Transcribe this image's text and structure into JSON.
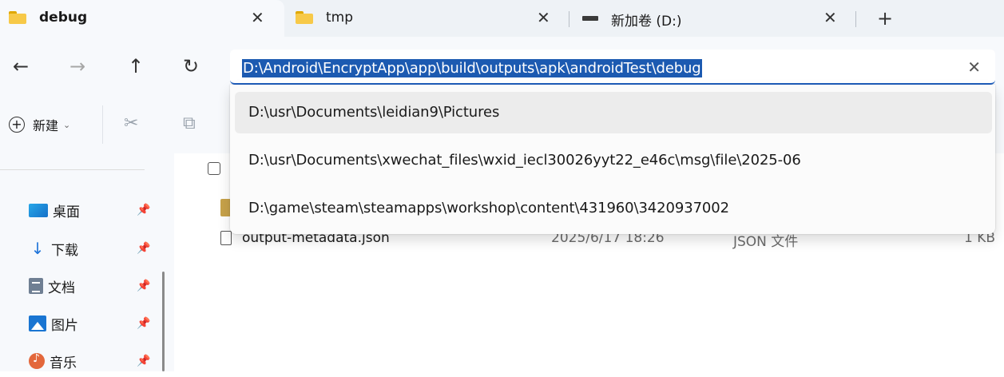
{
  "tabs": [
    {
      "title": "debug",
      "icon": "folder-icon",
      "active": true
    },
    {
      "title": "tmp",
      "icon": "folder-icon",
      "active": false
    },
    {
      "title": "新加卷 (D:)",
      "icon": "drive-icon",
      "active": false
    }
  ],
  "tab_close_glyph": "✕",
  "new_tab_glyph": "+",
  "nav": {
    "back": "←",
    "forward": "→",
    "up": "↑",
    "refresh": "↻"
  },
  "address": {
    "value": "D:\\Android\\EncryptApp\\app\\build\\outputs\\apk\\androidTest\\debug",
    "clear_glyph": "✕"
  },
  "suggestions": [
    "D:\\usr\\Documents\\leidian9\\Pictures",
    "D:\\usr\\Documents\\xwechat_files\\wxid_iecl30026yyt22_e46c\\msg\\file\\2025-06",
    "D:\\game\\steam\\steamapps\\workshop\\content\\431960\\3420937002"
  ],
  "commandbar": {
    "new_label": "新建",
    "new_chevron": "⌄",
    "cut_glyph": "✂",
    "copy_glyph": "⧉"
  },
  "sidebar": {
    "items": [
      {
        "label": "桌面",
        "icon": "desktop-icon"
      },
      {
        "label": "下载",
        "icon": "download-icon",
        "glyph": "↓"
      },
      {
        "label": "文档",
        "icon": "documents-icon"
      },
      {
        "label": "图片",
        "icon": "pictures-icon"
      },
      {
        "label": "音乐",
        "icon": "music-icon"
      }
    ],
    "pin_glyph": "📌"
  },
  "files": [
    {
      "name": "output-metadata.json",
      "date": "2025/6/17 18:26",
      "type": "JSON 文件",
      "size": "1 KB"
    }
  ],
  "colors": {
    "selection": "#1c5ab1",
    "accent": "#1f5fbf",
    "chrome": "#f7f9fc",
    "tabstrip": "#eef2f6"
  }
}
